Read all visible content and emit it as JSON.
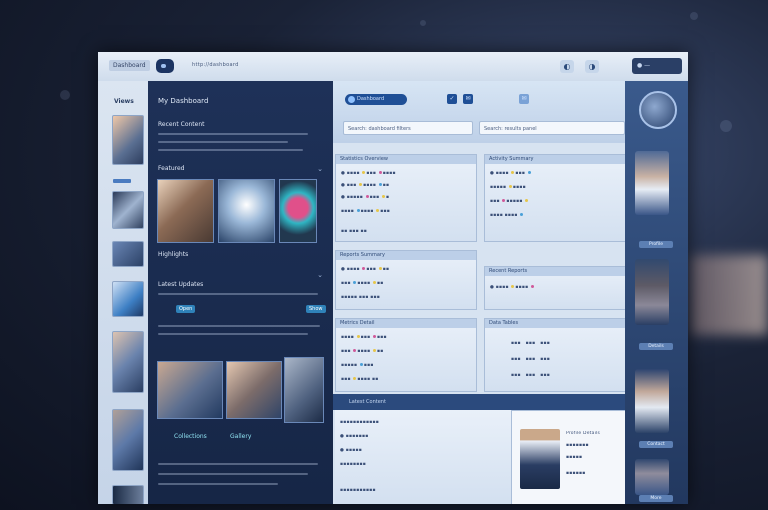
{
  "topbar": {
    "app_title": "Dashboard",
    "url_text": "http://dashboard",
    "icon_a": "◐",
    "icon_b": "◑",
    "window_controls": "● —"
  },
  "thumbs": {
    "label": "Views"
  },
  "dark_panel": {
    "title": "My Dashboard",
    "subtitle": "Recent Content",
    "section_label": "Featured",
    "section2_label": "Highlights",
    "section2_title": "Latest Updates",
    "chip_a": "Open",
    "chip_b": "Show",
    "caption_a": "Collections",
    "caption_b": "Gallery"
  },
  "right": {
    "pill_label": "Dashboard",
    "icon_1": "✓",
    "icon_2": "✉",
    "icon_3": "✉",
    "search_left": "Search: dashboard filters",
    "search_right": "Search: results panel",
    "card1_title": "Statistics Overview",
    "card2_title": "Activity Summary",
    "card3_title": "Reports Summary",
    "card4_title": "Recent Reports",
    "card5_title": "Metrics Detail",
    "card6_title": "Data Tables",
    "bottom_title": "Latest Content",
    "profile_text": "Profile Details"
  },
  "rside": {
    "tag_1": "Profile",
    "tag_2": "Details",
    "tag_3": "Contact",
    "tag_4": "More"
  },
  "colors": {
    "accent": "#1f4f96",
    "dark_panel": "#1e3158",
    "chip": "#2f82b9"
  }
}
